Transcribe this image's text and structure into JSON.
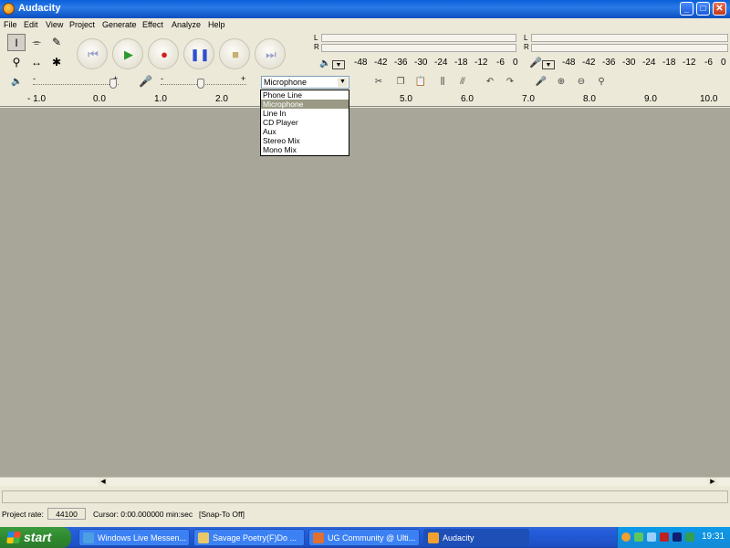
{
  "window": {
    "title": "Audacity",
    "controls": {
      "minimize": "_",
      "maximize": "□",
      "close": "✕"
    }
  },
  "menu": [
    "File",
    "Edit",
    "View",
    "Project",
    "Generate",
    "Effect",
    "Analyze",
    "Help"
  ],
  "tools": [
    {
      "name": "selection-tool-icon",
      "glyph": "I"
    },
    {
      "name": "envelope-tool-icon",
      "glyph": "⌯"
    },
    {
      "name": "draw-tool-icon",
      "glyph": "✎"
    },
    {
      "name": "zoom-tool-icon",
      "glyph": "⚲"
    },
    {
      "name": "timeshift-tool-icon",
      "glyph": "↔"
    },
    {
      "name": "multi-tool-icon",
      "glyph": "✱"
    }
  ],
  "transport": [
    {
      "name": "skip-start-button",
      "glyph": "⏮",
      "color": "#9aa0c8"
    },
    {
      "name": "play-button",
      "glyph": "▶",
      "color": "#2f9a2f"
    },
    {
      "name": "record-button",
      "glyph": "●",
      "color": "#d02020"
    },
    {
      "name": "pause-button",
      "glyph": "❚❚",
      "color": "#3050d0"
    },
    {
      "name": "stop-button",
      "glyph": "■",
      "color": "#c8b070"
    },
    {
      "name": "skip-end-button",
      "glyph": "⏭",
      "color": "#9aa0c8"
    }
  ],
  "meters": {
    "channel_left": "L",
    "channel_right": "R",
    "scale": [
      "-48",
      "-42",
      "-36",
      "-30",
      "-24",
      "-18",
      "-12",
      "-6",
      "0"
    ]
  },
  "mixer": {
    "volume_minus": "-",
    "volume_plus": "+",
    "input_minus": "-",
    "input_plus": "+"
  },
  "input_source": {
    "selected": "Microphone",
    "options": [
      "Phone Line",
      "Microphone",
      "Line In",
      "CD Player",
      "Aux",
      "Stereo Mix",
      "Mono Mix"
    ],
    "highlighted_index": 1
  },
  "ruler": [
    "- 1.0",
    "0.0",
    "1.0",
    "2.0",
    "5.0",
    "6.0",
    "7.0",
    "8.0",
    "9.0",
    "10.0"
  ],
  "status": {
    "project_rate_label": "Project rate:",
    "project_rate_value": "44100",
    "cursor_text": "Cursor: 0:00.000000 min:sec",
    "snap_text": "[Snap-To Off]"
  },
  "taskbar": {
    "start_label": "start",
    "items": [
      {
        "label": "Windows Live Messen...",
        "color": "#4aa0e0"
      },
      {
        "label": "Savage Poetry(F)Do ...",
        "color": "#e9c86a"
      },
      {
        "label": "UG Community @ Ulti...",
        "color": "#e07030"
      },
      {
        "label": "Audacity",
        "color": "#f0a030"
      }
    ],
    "clock": "19:31"
  }
}
